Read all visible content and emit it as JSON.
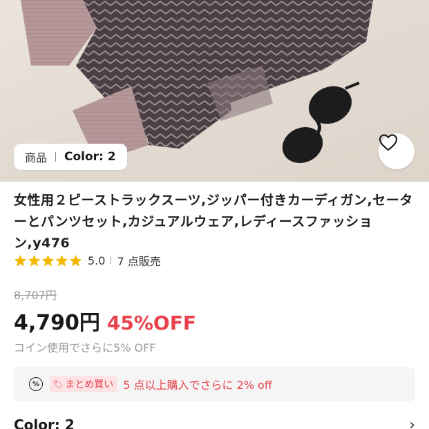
{
  "photo": {
    "tag_kind": "商品",
    "tag_variant": "Color: 2",
    "favorite_icon": "heart-outline-icon"
  },
  "product": {
    "title": "女性用２ピーストラックスーツ,ジッパー付きカーディガン,セーターとパンツセット,カジュアルウェア,レディースファッション,y476",
    "rating": "5.0",
    "sold": "7 点販売",
    "stars_filled": 5,
    "original_price": "8,707円",
    "price": "4,790円",
    "discount": "45%OFF",
    "coin_note": "コイン使用でさらに5% OFF"
  },
  "promo": {
    "icon": "percent-badge-icon",
    "chip_label": "まとめ買い",
    "text": "5 点以上購入でさらに 2% off"
  },
  "variant": {
    "label": "Color: 2",
    "chevron_icon": "chevron-right-icon"
  },
  "colors": {
    "accent_red": "#e8424c",
    "star_yellow": "#f5b800",
    "muted_gray": "#9a9a9a"
  }
}
